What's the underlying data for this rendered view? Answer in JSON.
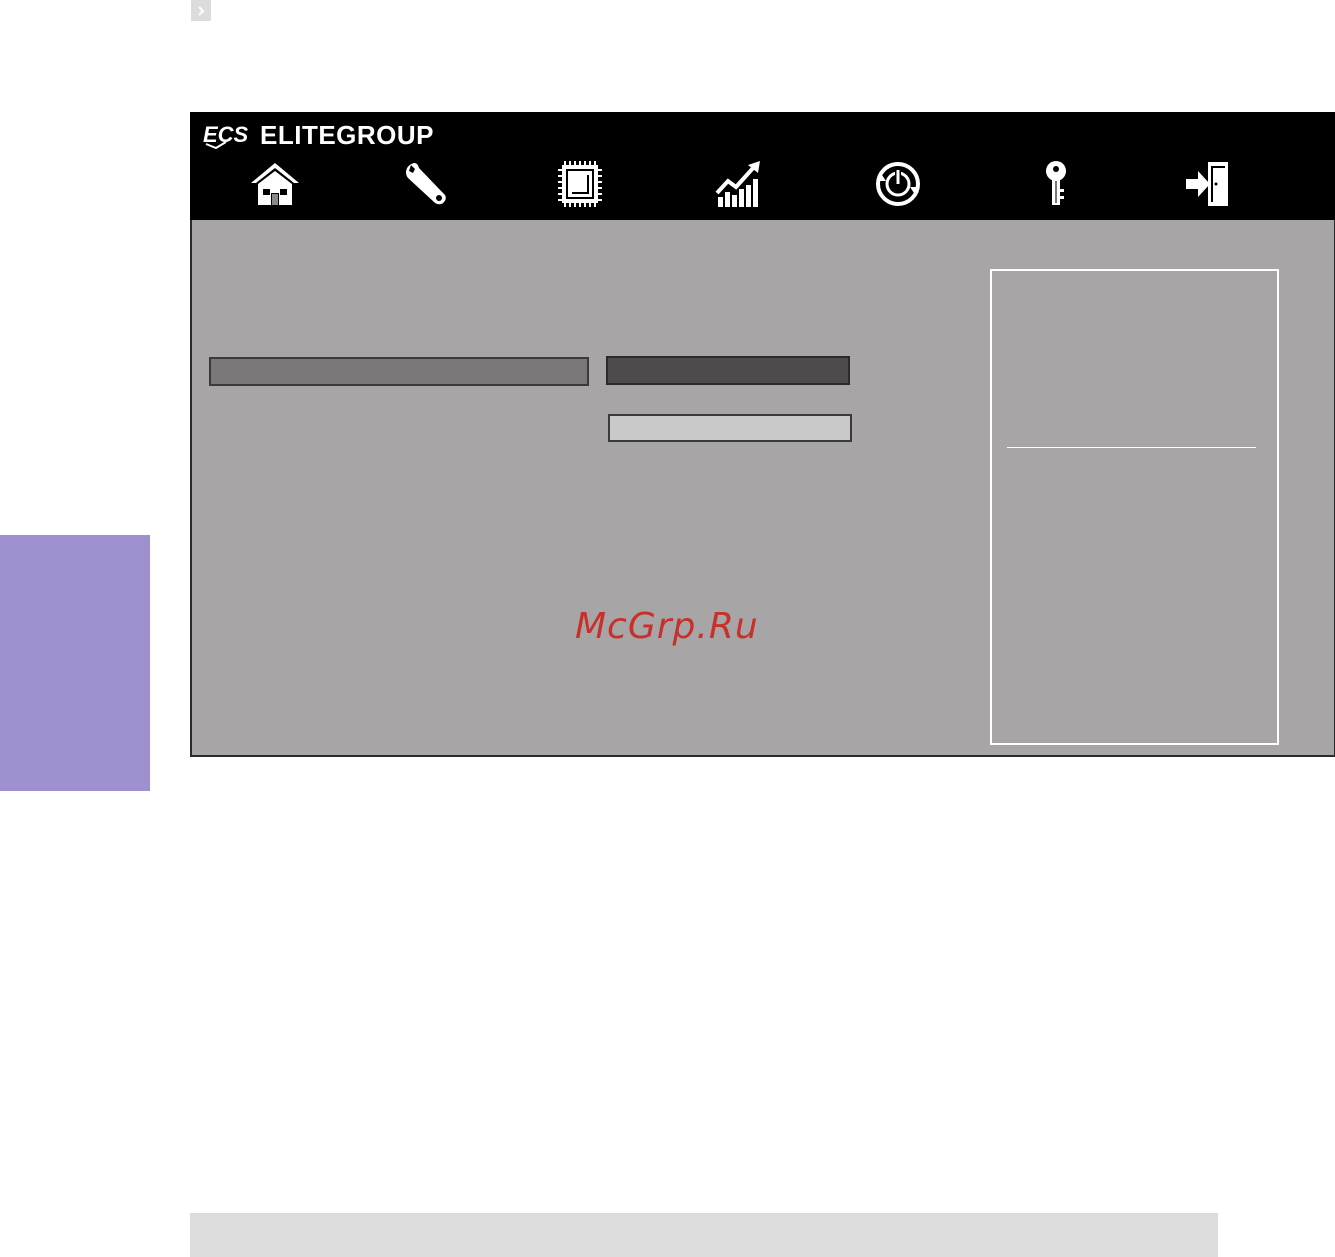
{
  "brand": {
    "name": "ELITEGROUP",
    "logo": "ECS"
  },
  "nav": {
    "items": [
      {
        "icon": "home-icon"
      },
      {
        "icon": "wrench-icon"
      },
      {
        "icon": "chip-icon"
      },
      {
        "icon": "performance-chart-icon"
      },
      {
        "icon": "power-icon"
      },
      {
        "icon": "key-icon"
      },
      {
        "icon": "exit-icon"
      }
    ]
  },
  "watermark": {
    "text": "McGrp.Ru"
  },
  "colors": {
    "header": "#000000",
    "body": "#a7a5a6",
    "side_tab": "#9e8fcf",
    "watermark": "#c8302c"
  }
}
